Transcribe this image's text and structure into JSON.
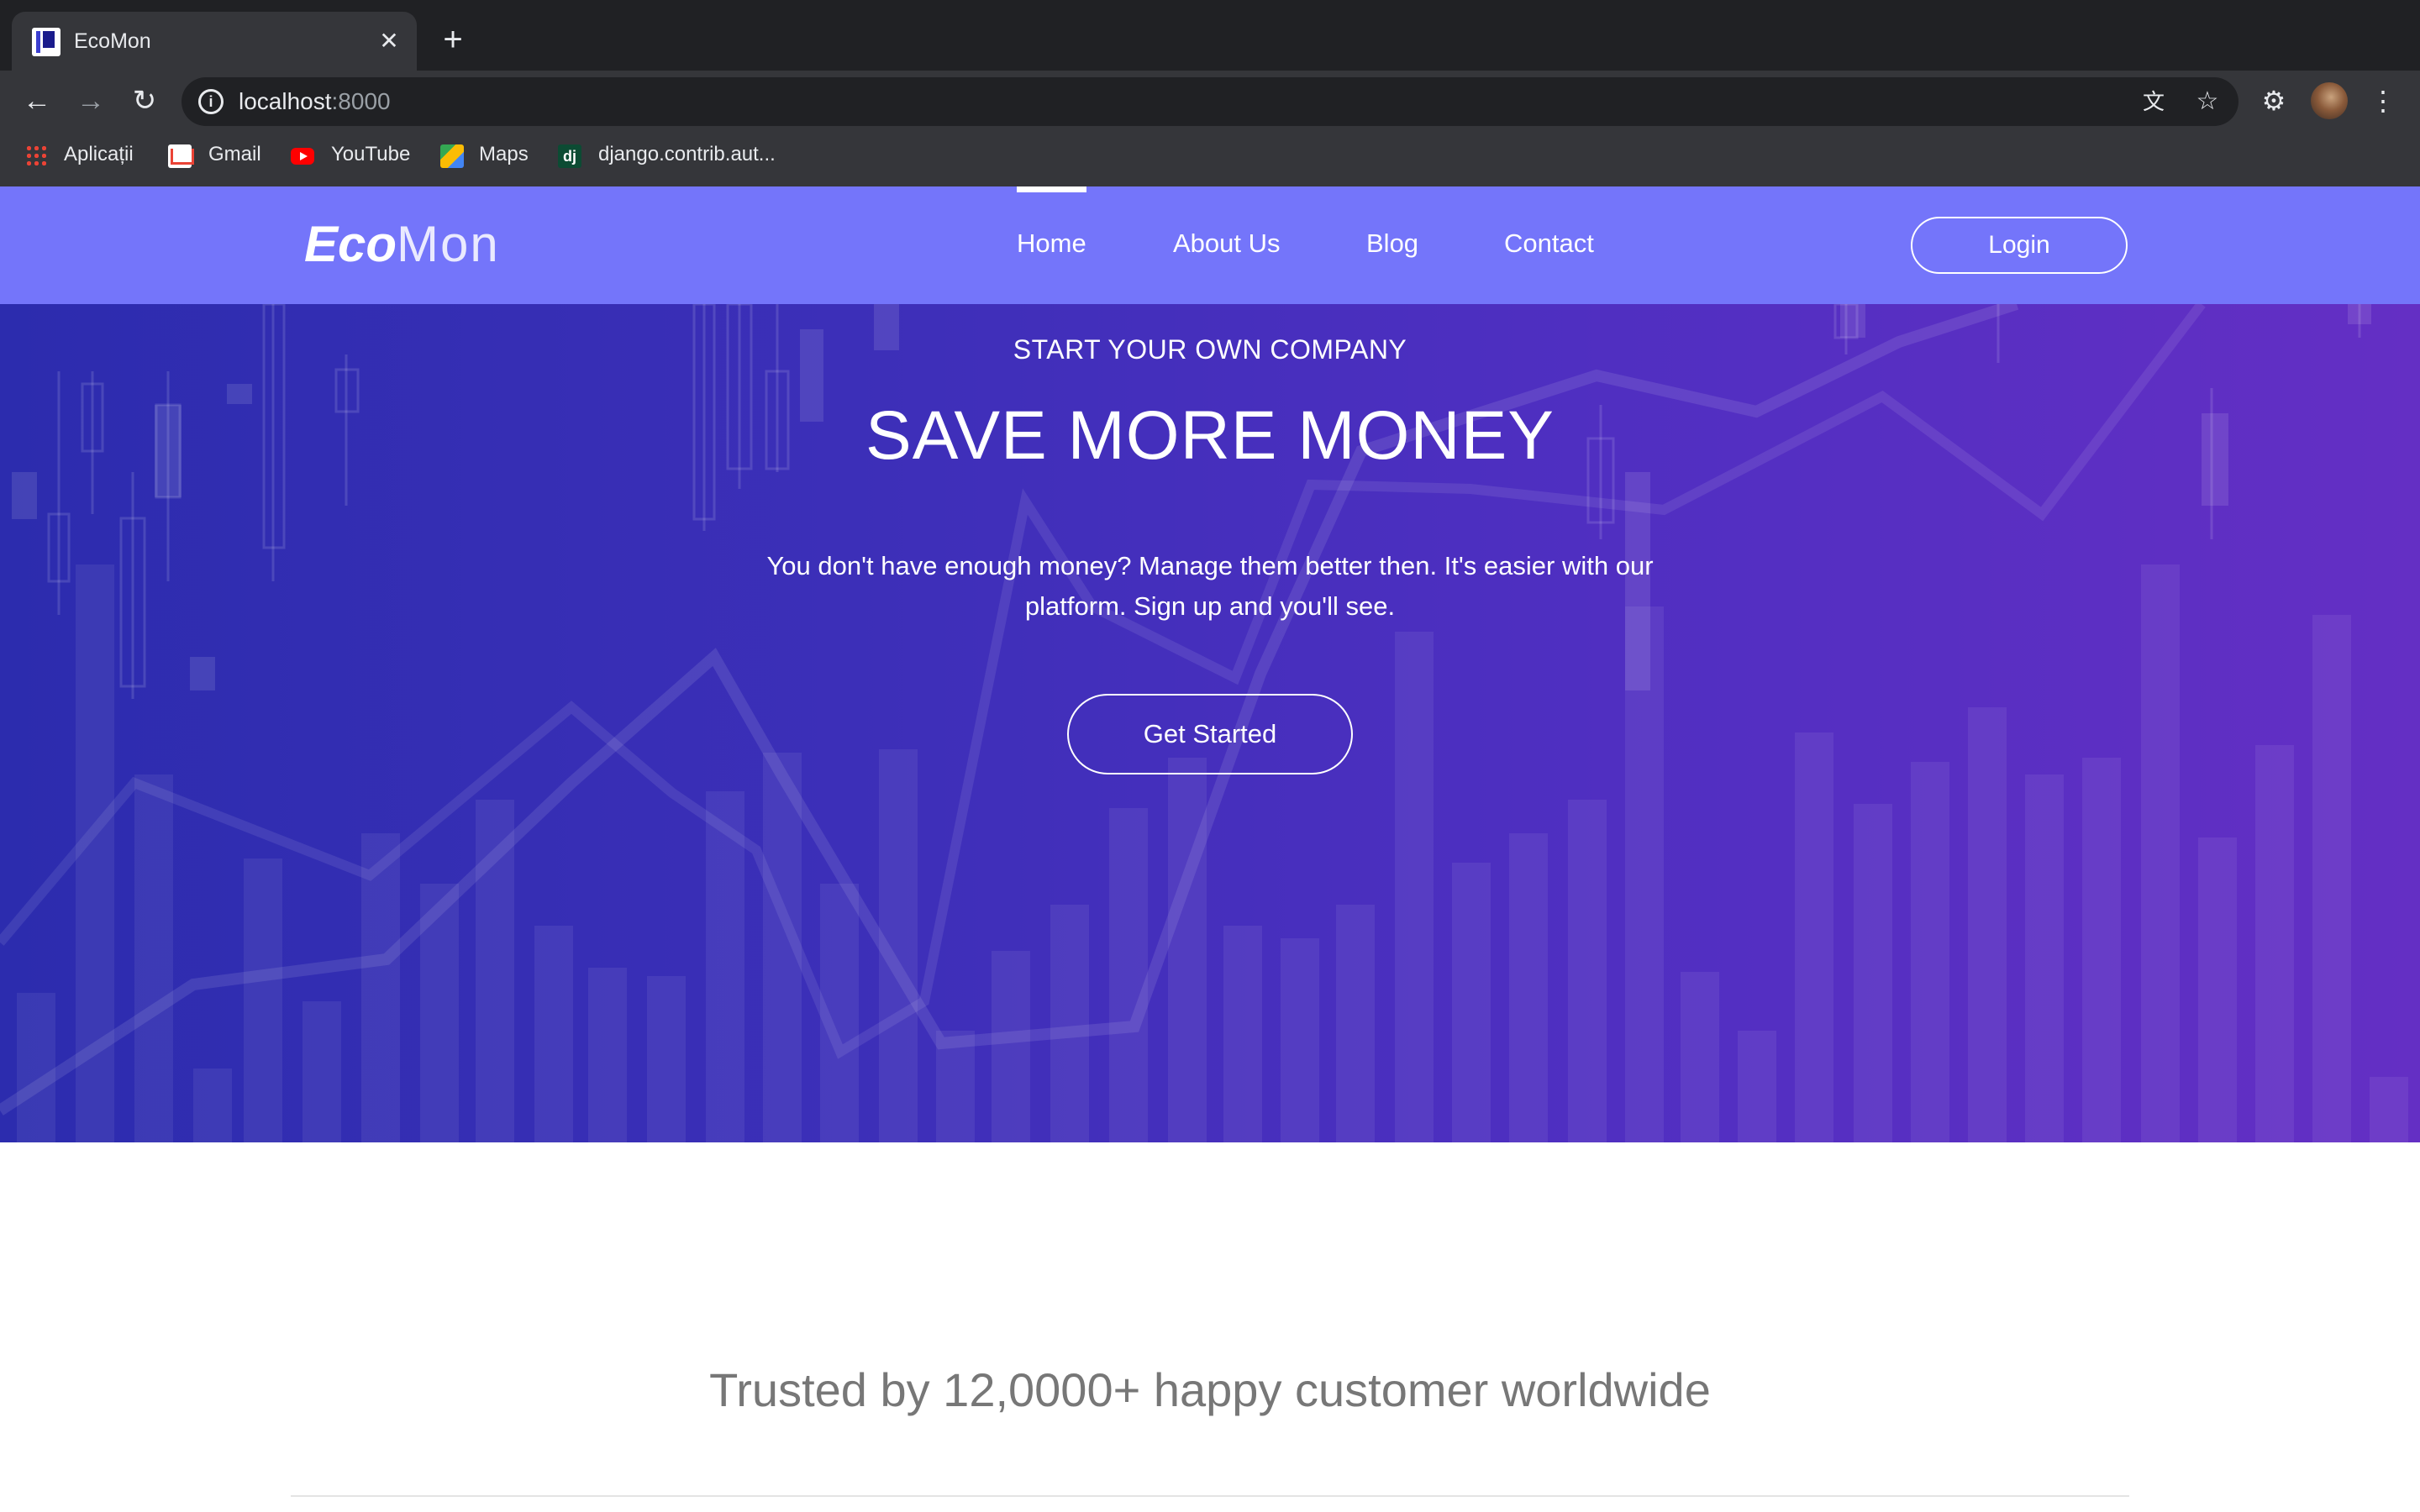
{
  "browser": {
    "tab_title": "EcoMon",
    "tab_close": "✕",
    "new_tab": "+",
    "url_host": "localhost",
    "url_port": ":8000",
    "bookmarks": [
      {
        "label": "Aplicații",
        "icon": "apps-grid-icon"
      },
      {
        "label": "Gmail",
        "icon": "gmail-icon"
      },
      {
        "label": "YouTube",
        "icon": "youtube-icon"
      },
      {
        "label": "Maps",
        "icon": "maps-icon"
      },
      {
        "label": "django.contrib.aut...",
        "icon": "django-icon"
      }
    ],
    "django_icon_text": "dj"
  },
  "site": {
    "logo_bold": "Eco",
    "logo_light": "Mon",
    "nav": [
      "Home",
      "About Us",
      "Blog",
      "Contact"
    ],
    "active_nav": "Home",
    "login_label": "Login",
    "hero": {
      "subtitle": "START YOUR OWN COMPANY",
      "title": "SAVE MORE MONEY",
      "description": "You don't have enough money? Manage them better then. It's easier with our platform. Sign up and you'll see.",
      "cta": "Get Started"
    },
    "trusted_text": "Trusted by 12,0000+ happy customer worldwide"
  },
  "colors": {
    "navbar": "#7475fa",
    "hero_start": "#2c2cae",
    "hero_end": "#642fc4",
    "chrome_dark": "#202124",
    "chrome_mid": "#35363a"
  }
}
